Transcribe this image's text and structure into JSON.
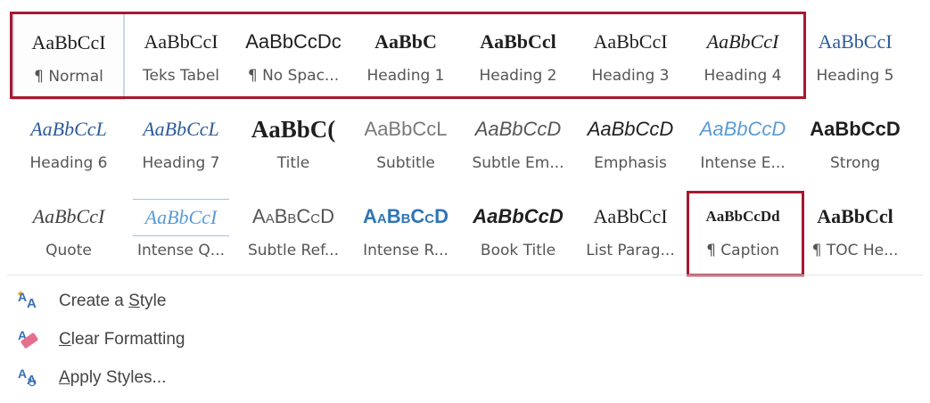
{
  "styles": [
    {
      "preview": "AaBbCcI",
      "label": "¶ Normal",
      "font": "serif",
      "selected": true,
      "name": "normal"
    },
    {
      "preview": "AaBbCcI",
      "label": "Teks Tabel",
      "font": "serif",
      "name": "teks-tabel"
    },
    {
      "preview": "AaBbCcDc",
      "label": "¶ No Spac...",
      "font": "sans",
      "name": "no-spacing"
    },
    {
      "preview": "AaBbC",
      "label": "Heading 1",
      "font": "serif-bold",
      "name": "heading-1"
    },
    {
      "preview": "AaBbCcl",
      "label": "Heading 2",
      "font": "serif-bold",
      "name": "heading-2"
    },
    {
      "preview": "AaBbCcI",
      "label": "Heading 3",
      "font": "serif",
      "name": "heading-3"
    },
    {
      "preview": "AaBbCcI",
      "label": "Heading 4",
      "font": "serif-italic",
      "name": "heading-4"
    },
    {
      "preview": "AaBbCcI",
      "label": "Heading 5",
      "font": "serif",
      "color": "#2e5c99",
      "name": "heading-5"
    },
    {
      "preview": "AaBbCcL",
      "label": "Heading 6",
      "font": "serif-italic",
      "color": "#2e5c99",
      "name": "heading-6"
    },
    {
      "preview": "AaBbCcL",
      "label": "Heading 7",
      "font": "serif-italic",
      "color": "#2e5c99",
      "name": "heading-7"
    },
    {
      "preview": "AaBbC(",
      "label": "Title",
      "font": "serif-bold",
      "big": true,
      "name": "title"
    },
    {
      "preview": "AaBbCcL",
      "label": "Subtitle",
      "font": "sans",
      "color": "#7a7a7a",
      "name": "subtitle"
    },
    {
      "preview": "AaBbCcD",
      "label": "Subtle Em...",
      "font": "sans-italic",
      "color": "#555555",
      "name": "subtle-emphasis"
    },
    {
      "preview": "AaBbCcD",
      "label": "Emphasis",
      "font": "sans-italic",
      "name": "emphasis"
    },
    {
      "preview": "AaBbCcD",
      "label": "Intense E...",
      "font": "sans-italic",
      "color": "#5b9bd5",
      "name": "intense-emphasis"
    },
    {
      "preview": "AaBbCcD",
      "label": "Strong",
      "font": "sans-bold",
      "name": "strong"
    },
    {
      "preview": "AaBbCcI",
      "label": "Quote",
      "font": "serif-italic",
      "color": "#444444",
      "name": "quote"
    },
    {
      "preview": "AaBbCcI",
      "label": "Intense Q...",
      "font": "serif-italic",
      "color": "#5b9bd5",
      "underline": true,
      "name": "intense-quote"
    },
    {
      "preview": "AaBbCcD",
      "label": "Subtle Ref...",
      "font": "sans",
      "smallcaps": true,
      "color": "#555555",
      "name": "subtle-reference"
    },
    {
      "preview": "AaBbCcD",
      "label": "Intense R...",
      "font": "sans-bold",
      "smallcaps": true,
      "color": "#2e75b6",
      "name": "intense-reference"
    },
    {
      "preview": "AaBbCcD",
      "label": "Book Title",
      "font": "sans-bolditalic",
      "name": "book-title"
    },
    {
      "preview": "AaBbCcI",
      "label": "List Parag...",
      "font": "serif",
      "name": "list-paragraph"
    },
    {
      "preview": "AaBbCcDd",
      "label": "¶ Caption",
      "font": "serif-bold",
      "small": true,
      "name": "caption"
    },
    {
      "preview": "AaBbCcl",
      "label": "¶ TOC He...",
      "font": "serif-bold",
      "name": "toc-heading"
    }
  ],
  "actions": [
    {
      "label_pre": "Create a ",
      "label_u": "S",
      "label_post": "tyle",
      "icon": "create-style-icon"
    },
    {
      "label_pre": "",
      "label_u": "C",
      "label_post": "lear Formatting",
      "icon": "clear-formatting-icon"
    },
    {
      "label_pre": "",
      "label_u": "A",
      "label_post": "pply Styles...",
      "icon": "apply-styles-icon"
    }
  ],
  "colors": {
    "highlight": "#a6192e",
    "accent": "#2e5c99"
  }
}
